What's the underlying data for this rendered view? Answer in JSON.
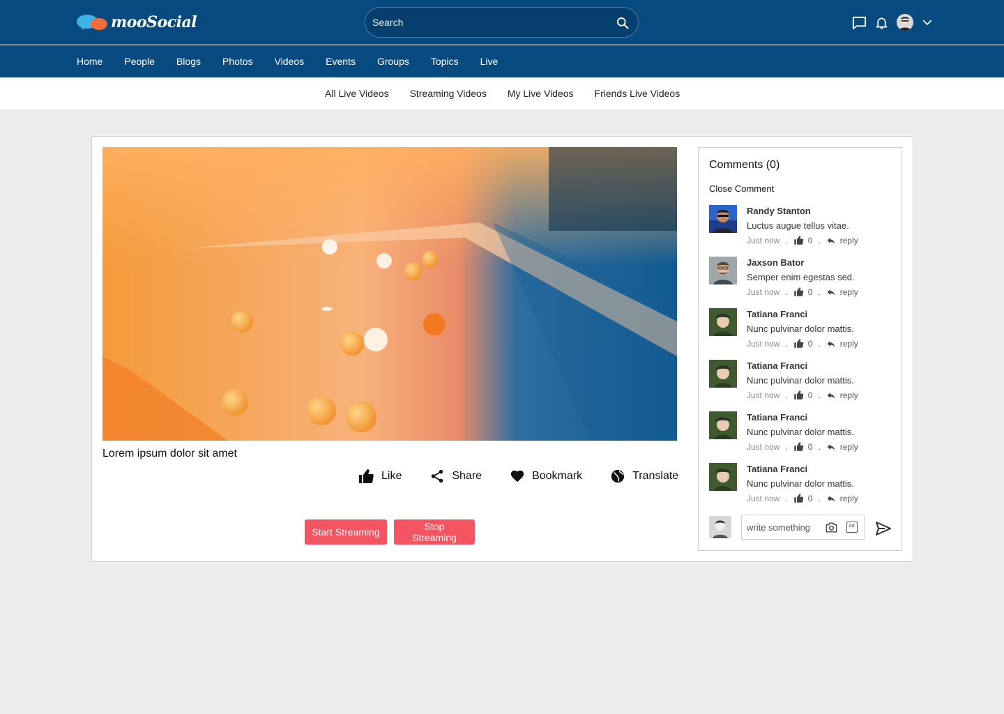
{
  "brand": {
    "name": "mooSocial"
  },
  "search": {
    "placeholder": "Search"
  },
  "main_nav": [
    "Home",
    "People",
    "Blogs",
    "Photos",
    "Videos",
    "Events",
    "Groups",
    "Topics",
    "Live"
  ],
  "sub_nav": [
    "All Live Videos",
    "Streaming Videos",
    "My Live Videos",
    "Friends Live Videos"
  ],
  "video": {
    "caption": "Lorem ipsum dolor sit amet",
    "actions": {
      "like": "Like",
      "share": "Share",
      "bookmark": "Bookmark",
      "translate": "Translate"
    }
  },
  "streaming": {
    "start": "Start Streaming",
    "stop": "Stop Streaming"
  },
  "comments": {
    "title": "Comments (0)",
    "close_label": "Close Comment",
    "items": [
      {
        "author": "Randy Stanton",
        "text": "Luctus augue tellus vitae.",
        "time": "Just now",
        "likes": "0",
        "reply": "reply"
      },
      {
        "author": "Jaxson Bator",
        "text": "Semper enim egestas sed.",
        "time": "Just now",
        "likes": "0",
        "reply": "reply"
      },
      {
        "author": "Tatiana Franci",
        "text": "Nunc pulvinar dolor mattis.",
        "time": "Just now",
        "likes": "0",
        "reply": "reply"
      },
      {
        "author": "Tatiana Franci",
        "text": "Nunc pulvinar dolor mattis.",
        "time": "Just now",
        "likes": "0",
        "reply": "reply"
      },
      {
        "author": "Tatiana Franci",
        "text": "Nunc pulvinar dolor mattis.",
        "time": "Just now",
        "likes": "0",
        "reply": "reply"
      },
      {
        "author": "Tatiana Franci",
        "text": "Nunc pulvinar dolor mattis.",
        "time": "Just now",
        "likes": "0",
        "reply": "reply"
      }
    ],
    "compose_placeholder": "write something"
  },
  "colors": {
    "header": "#064a80",
    "accent_red": "#f35461",
    "page_bg": "#ececec"
  },
  "icons": [
    "search-icon",
    "chat-icon",
    "bell-icon",
    "chevron-down-icon",
    "like-icon",
    "share-icon",
    "heart-icon",
    "globe-icon",
    "reply-icon",
    "camera-icon",
    "gif-icon",
    "send-icon"
  ]
}
